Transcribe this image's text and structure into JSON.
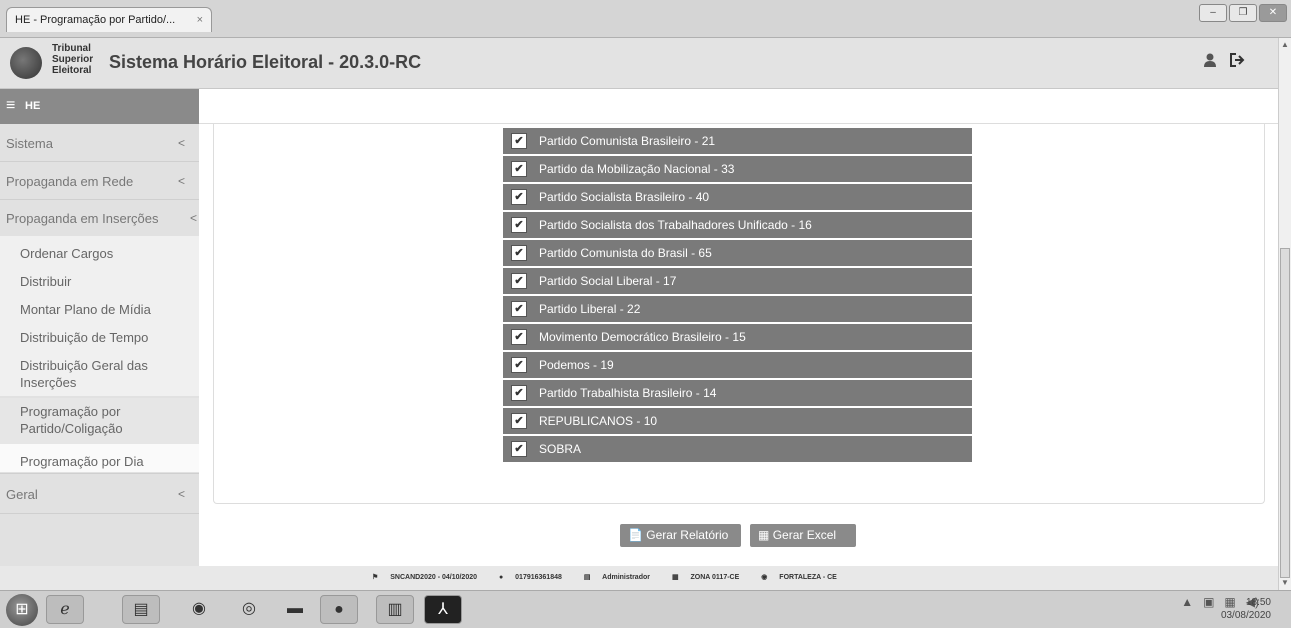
{
  "browser": {
    "tab_title": "HE - Programação por Partido/...",
    "tab_close": "×",
    "win_min": "–",
    "win_max": "❐",
    "win_close": "✕"
  },
  "header": {
    "logo_line1": "Tribunal",
    "logo_line2": "Superior",
    "logo_line3": "Eleitoral",
    "title": "Sistema Horário Eleitoral - 20.3.0-RC",
    "user_icon": "user-icon",
    "logout_icon": "logout-icon"
  },
  "navbar": {
    "menu_icon": "≡",
    "label": "HE"
  },
  "sidebar": {
    "items": [
      {
        "label": "Sistema",
        "chevron": "<"
      },
      {
        "label": "Propaganda em Rede",
        "chevron": "<"
      },
      {
        "label": "Propaganda em Inserções",
        "chevron": "<"
      }
    ],
    "sub_items": [
      "Ordenar Cargos",
      "Distribuir",
      "Montar Plano de Mídia",
      "Distribuição de Tempo",
      "Distribuição Geral das Inserções",
      "Programação por Partido/Coligação",
      "Programação por Dia"
    ],
    "geral": {
      "label": "Geral",
      "chevron": "<"
    }
  },
  "parties": [
    "Partido Comunista Brasileiro - 21",
    "Partido da Mobilização Nacional - 33",
    "Partido Socialista Brasileiro - 40",
    "Partido Socialista dos Trabalhadores Unificado - 16",
    "Partido Comunista do Brasil - 65",
    "Partido Social Liberal - 17",
    "Partido Liberal - 22",
    "Movimento Democrático Brasileiro - 15",
    "Podemos - 19",
    "Partido Trabalhista Brasileiro - 14",
    "REPUBLICANOS - 10",
    "SOBRA"
  ],
  "check_glyph": "✔",
  "buttons": {
    "report": "Gerar Relatório",
    "excel": "Gerar Excel"
  },
  "status": {
    "version": "SNCAND2020 - 04/10/2020",
    "user": "017916361848",
    "role": "Administrador",
    "zone": "ZONA 0117-CE",
    "city": "FORTALEZA  -  CE"
  },
  "taskbar": {
    "time": "18:50",
    "date": "03/08/2020"
  },
  "colors": {
    "row_bg": "#7a7a7a",
    "sidebar_bg": "#e1e1e1",
    "navbar_bg": "#8a8a8a"
  }
}
